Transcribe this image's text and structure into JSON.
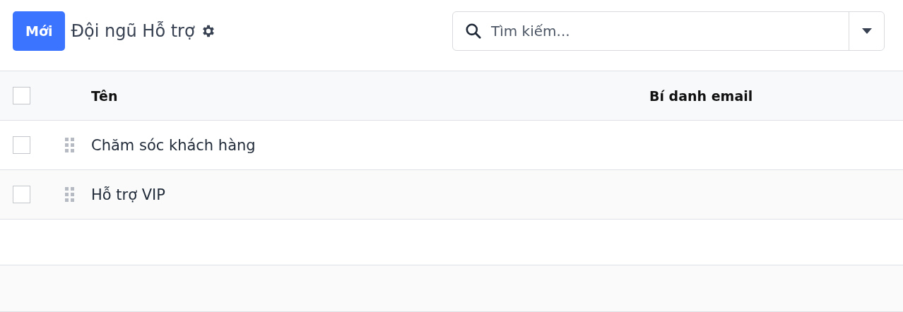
{
  "new_button": "Mới",
  "title": "Đội ngũ Hỗ trợ",
  "search": {
    "placeholder": "Tìm kiếm..."
  },
  "table": {
    "select_all_checked": false,
    "columns": [
      "Tên",
      "Bí danh email"
    ],
    "rows": [
      {
        "checked": false,
        "name": "Chăm sóc khách hàng"
      },
      {
        "checked": false,
        "name": "Hỗ trợ VIP"
      }
    ]
  }
}
